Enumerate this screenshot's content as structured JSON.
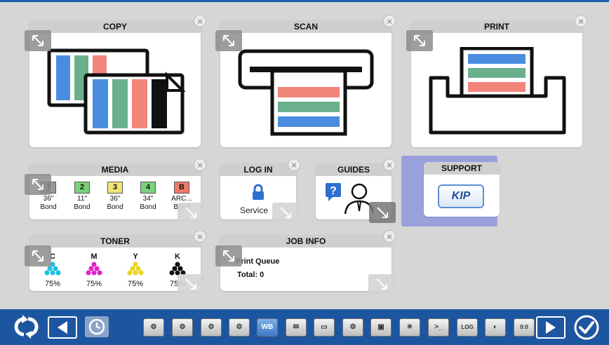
{
  "tiles": {
    "copy": {
      "title": "COPY"
    },
    "scan": {
      "title": "SCAN"
    },
    "print": {
      "title": "PRINT"
    },
    "media": {
      "title": "MEDIA",
      "slots": [
        {
          "num": "1",
          "size": "36\"",
          "type": "Bond",
          "color": "#9a9a9a"
        },
        {
          "num": "2",
          "size": "11\"",
          "type": "Bond",
          "color": "#79d279"
        },
        {
          "num": "3",
          "size": "36\"",
          "type": "Bond",
          "color": "#f3e477"
        },
        {
          "num": "4",
          "size": "34\"",
          "type": "Bond",
          "color": "#79d279"
        },
        {
          "num": "B",
          "size": "ARC...",
          "type": "Bond",
          "color": "#f07a6a"
        }
      ]
    },
    "login": {
      "title": "LOG IN",
      "user": "Service"
    },
    "guides": {
      "title": "GUIDES"
    },
    "support": {
      "title": "SUPPORT",
      "logo_text": "KIP"
    },
    "toner": {
      "title": "TONER",
      "items": [
        {
          "letter": "C",
          "percent": "75%",
          "color": "#19c1e0"
        },
        {
          "letter": "M",
          "percent": "75%",
          "color": "#e023c8"
        },
        {
          "letter": "Y",
          "percent": "75%",
          "color": "#ecd41a"
        },
        {
          "letter": "K",
          "percent": "75%",
          "color": "#111111"
        }
      ]
    },
    "jobinfo": {
      "title": "JOB INFO",
      "queue_label": "Print Queue",
      "total_label": "Total: 0"
    }
  },
  "toolbar": {
    "tools": [
      {
        "name": "settings-gear-icon",
        "label": "⚙"
      },
      {
        "name": "settings-copy-icon",
        "label": "⚙"
      },
      {
        "name": "settings-scan-icon",
        "label": "⚙"
      },
      {
        "name": "settings-print-icon",
        "label": "⚙"
      },
      {
        "name": "wb-icon",
        "label": "WB"
      },
      {
        "name": "folder-icon",
        "label": "✉"
      },
      {
        "name": "message-icon",
        "label": "▭"
      },
      {
        "name": "network-icon",
        "label": "⚙"
      },
      {
        "name": "user-admin-icon",
        "label": "▣"
      },
      {
        "name": "starburst-icon",
        "label": "✳"
      },
      {
        "name": "terminal-icon",
        "label": ">_"
      },
      {
        "name": "log-icon",
        "label": "LOG"
      },
      {
        "name": "toggle-icon",
        "label": "◐"
      },
      {
        "name": "counter-icon",
        "label": "0:0"
      }
    ]
  },
  "colors": {
    "bar": "#1d56a0",
    "accent_blue": "#4a8de0",
    "green": "#6ab08c",
    "salmon": "#f2857a"
  }
}
